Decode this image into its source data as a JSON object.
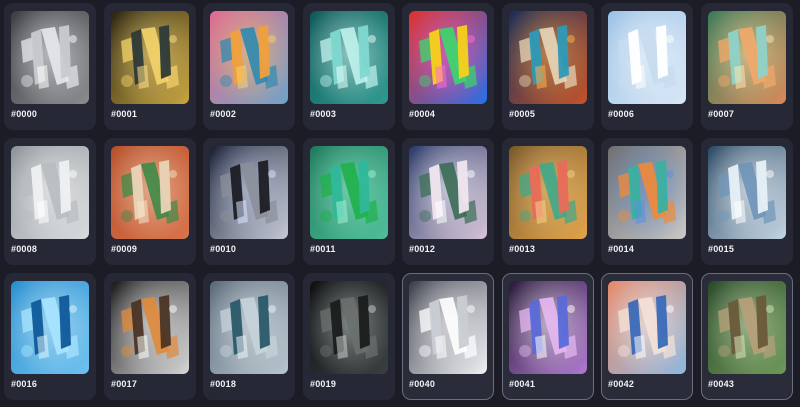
{
  "gallery": {
    "items": [
      {
        "label": "#0000",
        "palette": {
          "bg": [
            "#3c3e42",
            "#8a8c90"
          ],
          "panel": "#c7cbd1",
          "accent": "#e6e8ec",
          "glow": "#ffffff"
        },
        "selected": false
      },
      {
        "label": "#0001",
        "palette": {
          "bg": [
            "#2a2412",
            "#c9a640"
          ],
          "panel": "#2e3a38",
          "accent": "#f3d36a",
          "glow": "#ffe28a"
        },
        "selected": false
      },
      {
        "label": "#0002",
        "palette": {
          "bg": [
            "#e36b8f",
            "#6fa4c8"
          ],
          "panel": "#f0a03c",
          "accent": "#2f8ab0",
          "glow": "#f7d26b"
        },
        "selected": false
      },
      {
        "label": "#0003",
        "palette": {
          "bg": [
            "#0f5a5a",
            "#2f9a90"
          ],
          "panel": "#7fd8d0",
          "accent": "#bff2ec",
          "glow": "#e8fffb"
        },
        "selected": false
      },
      {
        "label": "#0004",
        "palette": {
          "bg": [
            "#e0322c",
            "#2b6ee8"
          ],
          "panel": "#f5d21a",
          "accent": "#38d96a",
          "glow": "#ff6bd6"
        },
        "selected": false
      },
      {
        "label": "#0005",
        "palette": {
          "bg": [
            "#1b2e5a",
            "#c3542a"
          ],
          "panel": "#2d9ab7",
          "accent": "#e7d7b9",
          "glow": "#ffb14a"
        },
        "selected": false
      },
      {
        "label": "#0006",
        "palette": {
          "bg": [
            "#9cc2e6",
            "#d7e7f5"
          ],
          "panel": "#ffffff",
          "accent": "#c7dcf0",
          "glow": "#ffffff"
        },
        "selected": false
      },
      {
        "label": "#0007",
        "palette": {
          "bg": [
            "#3b7b5a",
            "#d88b59"
          ],
          "panel": "#8fd2c8",
          "accent": "#f1a86a",
          "glow": "#ffe6b0"
        },
        "selected": false
      },
      {
        "label": "#0008",
        "palette": {
          "bg": [
            "#8d9499",
            "#d9dde0"
          ],
          "panel": "#eef0f1",
          "accent": "#b7bcc0",
          "glow": "#ffffff"
        },
        "selected": false
      },
      {
        "label": "#0009",
        "palette": {
          "bg": [
            "#b8502c",
            "#d8734b"
          ],
          "panel": "#e9d4b8",
          "accent": "#3f8a47",
          "glow": "#f6e3c8"
        },
        "selected": false
      },
      {
        "label": "#0010",
        "palette": {
          "bg": [
            "#1a2036",
            "#c7cad6"
          ],
          "panel": "#1c1d24",
          "accent": "#8b8f9a",
          "glow": "#d7e3ff"
        },
        "selected": false
      },
      {
        "label": "#0011",
        "palette": {
          "bg": [
            "#1f7a5c",
            "#4fc09a"
          ],
          "panel": "#2fb89a",
          "accent": "#1fb04a",
          "glow": "#9ff0d4"
        },
        "selected": false
      },
      {
        "label": "#0012",
        "palette": {
          "bg": [
            "#2a3a6a",
            "#d8c5d8"
          ],
          "panel": "#f0e6ef",
          "accent": "#3b6d55",
          "glow": "#ffffff"
        },
        "selected": false
      },
      {
        "label": "#0013",
        "palette": {
          "bg": [
            "#7a5a2a",
            "#e3a44c"
          ],
          "panel": "#e86c5a",
          "accent": "#3fa88a",
          "glow": "#f7d08a"
        },
        "selected": false
      },
      {
        "label": "#0014",
        "palette": {
          "bg": [
            "#6f6f6f",
            "#c8c8c8"
          ],
          "panel": "#3ab0a0",
          "accent": "#f08a3a",
          "glow": "#5a8fe0"
        },
        "selected": false
      },
      {
        "label": "#0015",
        "palette": {
          "bg": [
            "#2c4a66",
            "#c4d6e4"
          ],
          "panel": "#e6f0f7",
          "accent": "#6f95b8",
          "glow": "#ffffff"
        },
        "selected": false
      },
      {
        "label": "#0016",
        "palette": {
          "bg": [
            "#2a8fd0",
            "#6fc2ee"
          ],
          "panel": "#0f5a9a",
          "accent": "#a9e4ff",
          "glow": "#e0f6ff"
        },
        "selected": false
      },
      {
        "label": "#0017",
        "palette": {
          "bg": [
            "#1a1a1a",
            "#d8d8d8"
          ],
          "panel": "#4a3424",
          "accent": "#e08a3a",
          "glow": "#ffffff"
        },
        "selected": false
      },
      {
        "label": "#0018",
        "palette": {
          "bg": [
            "#5a6a7a",
            "#b8c6cf"
          ],
          "panel": "#2a5a6a",
          "accent": "#c7d3da",
          "glow": "#eef4f7"
        },
        "selected": false
      },
      {
        "label": "#0019",
        "palette": {
          "bg": [
            "#0e1012",
            "#3a4042"
          ],
          "panel": "#1a1c1e",
          "accent": "#6a706e",
          "glow": "#c8cfcc"
        },
        "selected": false
      },
      {
        "label": "#0040",
        "palette": {
          "bg": [
            "#3a3f4a",
            "#f0f2f5"
          ],
          "panel": "#c9cdd4",
          "accent": "#ffffff",
          "glow": "#ffffff"
        },
        "selected": true
      },
      {
        "label": "#0041",
        "palette": {
          "bg": [
            "#2a1a3a",
            "#b07ad0"
          ],
          "panel": "#5a6ad8",
          "accent": "#e6b8f0",
          "glow": "#ffffff"
        },
        "selected": true
      },
      {
        "label": "#0042",
        "palette": {
          "bg": [
            "#e58a6a",
            "#8fb8e0"
          ],
          "panel": "#3a6ab8",
          "accent": "#f3e2d8",
          "glow": "#ffffff"
        },
        "selected": true
      },
      {
        "label": "#0043",
        "palette": {
          "bg": [
            "#2a4a2a",
            "#6f9a5a"
          ],
          "panel": "#6a5a3a",
          "accent": "#b8a07a",
          "glow": "#d8e6c0"
        },
        "selected": true
      }
    ]
  }
}
